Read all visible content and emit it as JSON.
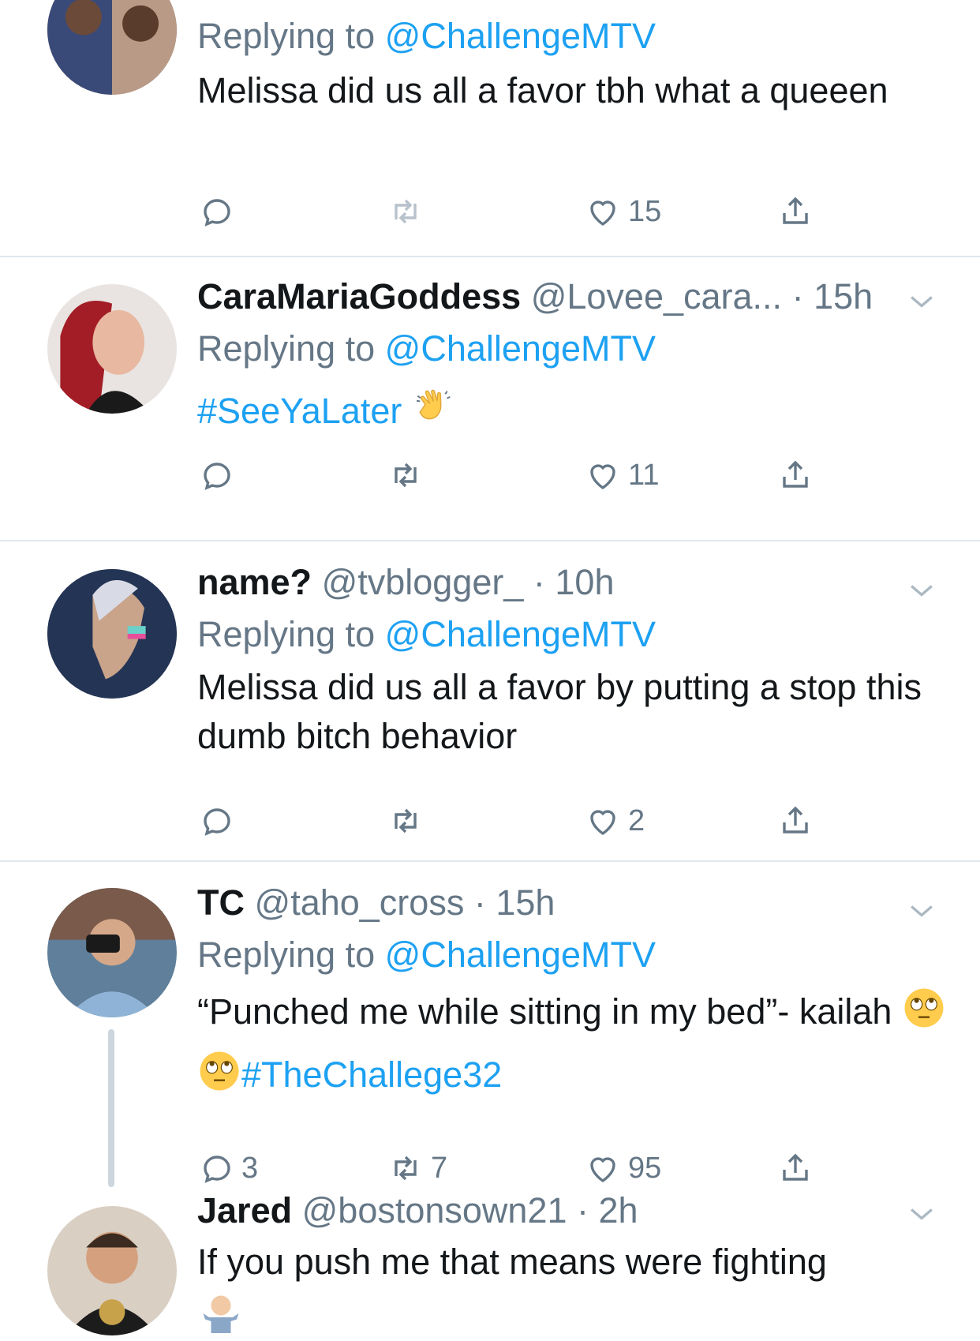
{
  "tweets": [
    {
      "reply_prefix": "Replying to ",
      "reply_to": "@ChallengeMTV",
      "text": "Melissa did us all a favor tbh what a queeen",
      "stats": {
        "replies": "",
        "retweets": "",
        "likes": "15"
      }
    },
    {
      "name": "CaraMariaGoddess",
      "handle": "@Lovee_cara...",
      "time": "15h",
      "reply_prefix": "Replying to ",
      "reply_to": "@ChallengeMTV",
      "hashtag": "#SeeYaLater",
      "emoji": "waving-hand-icon",
      "stats": {
        "replies": "",
        "retweets": "",
        "likes": "11"
      }
    },
    {
      "name": "name?",
      "handle": "@tvblogger_",
      "time": "10h",
      "reply_prefix": "Replying to ",
      "reply_to": "@ChallengeMTV",
      "text": "Melissa did us all a favor by putting a stop this dumb bitch behavior",
      "stats": {
        "replies": "",
        "retweets": "",
        "likes": "2"
      }
    },
    {
      "name": "TC",
      "handle": "@taho_cross",
      "time": "15h",
      "reply_prefix": "Replying to ",
      "reply_to": "@ChallengeMTV",
      "text": "“Punched me while sitting in my bed”- kailah ",
      "hashtag": "#TheChallege32",
      "emoji": "eye-roll-icon",
      "stats": {
        "replies": "3",
        "retweets": "7",
        "likes": "95"
      }
    },
    {
      "name": "Jared",
      "handle": "@bostonsown21",
      "time": "2h",
      "text": "If you push me that means were fighting",
      "emoji": "shrug-icon"
    }
  ],
  "colors": {
    "link": "#1da1f2",
    "muted": "#657786",
    "divider": "#e1e8ed"
  }
}
